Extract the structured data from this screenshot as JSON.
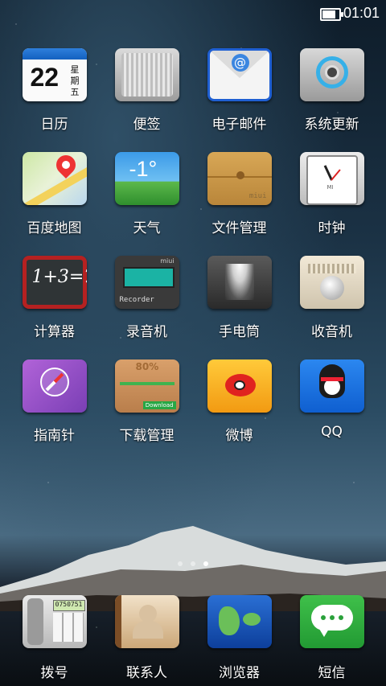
{
  "status_bar": {
    "time": "01:01",
    "battery_icon": "battery-icon"
  },
  "apps": [
    {
      "name": "app-calendar",
      "label": "日历",
      "icon": "calendar-icon",
      "icon_text": {
        "date": "22",
        "weekday": "星期五"
      }
    },
    {
      "name": "app-notes",
      "label": "便签",
      "icon": "notes-icon"
    },
    {
      "name": "app-email",
      "label": "电子邮件",
      "icon": "email-icon"
    },
    {
      "name": "app-update",
      "label": "系统更新",
      "icon": "update-icon"
    },
    {
      "name": "app-maps",
      "label": "百度地图",
      "icon": "map-icon"
    },
    {
      "name": "app-weather",
      "label": "天气",
      "icon": "weather-icon",
      "icon_text": {
        "temp": "-1°"
      }
    },
    {
      "name": "app-files",
      "label": "文件管理",
      "icon": "folder-icon",
      "icon_text": {
        "tag": "miui"
      }
    },
    {
      "name": "app-clock",
      "label": "时钟",
      "icon": "clock-icon",
      "icon_text": {
        "brand": "MI"
      }
    },
    {
      "name": "app-calculator",
      "label": "计算器",
      "icon": "calculator-icon",
      "icon_text": {
        "formula": "1+3=?"
      }
    },
    {
      "name": "app-recorder",
      "label": "录音机",
      "icon": "recorder-icon",
      "icon_text": {
        "title": "Recorder",
        "brand": "miui"
      }
    },
    {
      "name": "app-torch",
      "label": "手电筒",
      "icon": "flashlight-icon"
    },
    {
      "name": "app-radio",
      "label": "收音机",
      "icon": "radio-icon"
    },
    {
      "name": "app-compass",
      "label": "指南针",
      "icon": "compass-icon"
    },
    {
      "name": "app-downloads",
      "label": "下载管理",
      "icon": "download-icon",
      "icon_text": {
        "percent": "80%",
        "badge": "Download"
      }
    },
    {
      "name": "app-weibo",
      "label": "微博",
      "icon": "weibo-icon"
    },
    {
      "name": "app-qq",
      "label": "QQ",
      "icon": "qq-icon"
    }
  ],
  "page_indicator": {
    "count": 3,
    "active": 2
  },
  "dock": [
    {
      "name": "dock-dialer",
      "label": "拨号",
      "icon": "phone-icon",
      "icon_text": {
        "screen": "0750751"
      }
    },
    {
      "name": "dock-contacts",
      "label": "联系人",
      "icon": "contacts-icon"
    },
    {
      "name": "dock-browser",
      "label": "浏览器",
      "icon": "browser-icon"
    },
    {
      "name": "dock-sms",
      "label": "短信",
      "icon": "sms-icon"
    }
  ],
  "colors": {
    "label_text": "#ffffff",
    "accent_blue": "#1f5fd2"
  }
}
